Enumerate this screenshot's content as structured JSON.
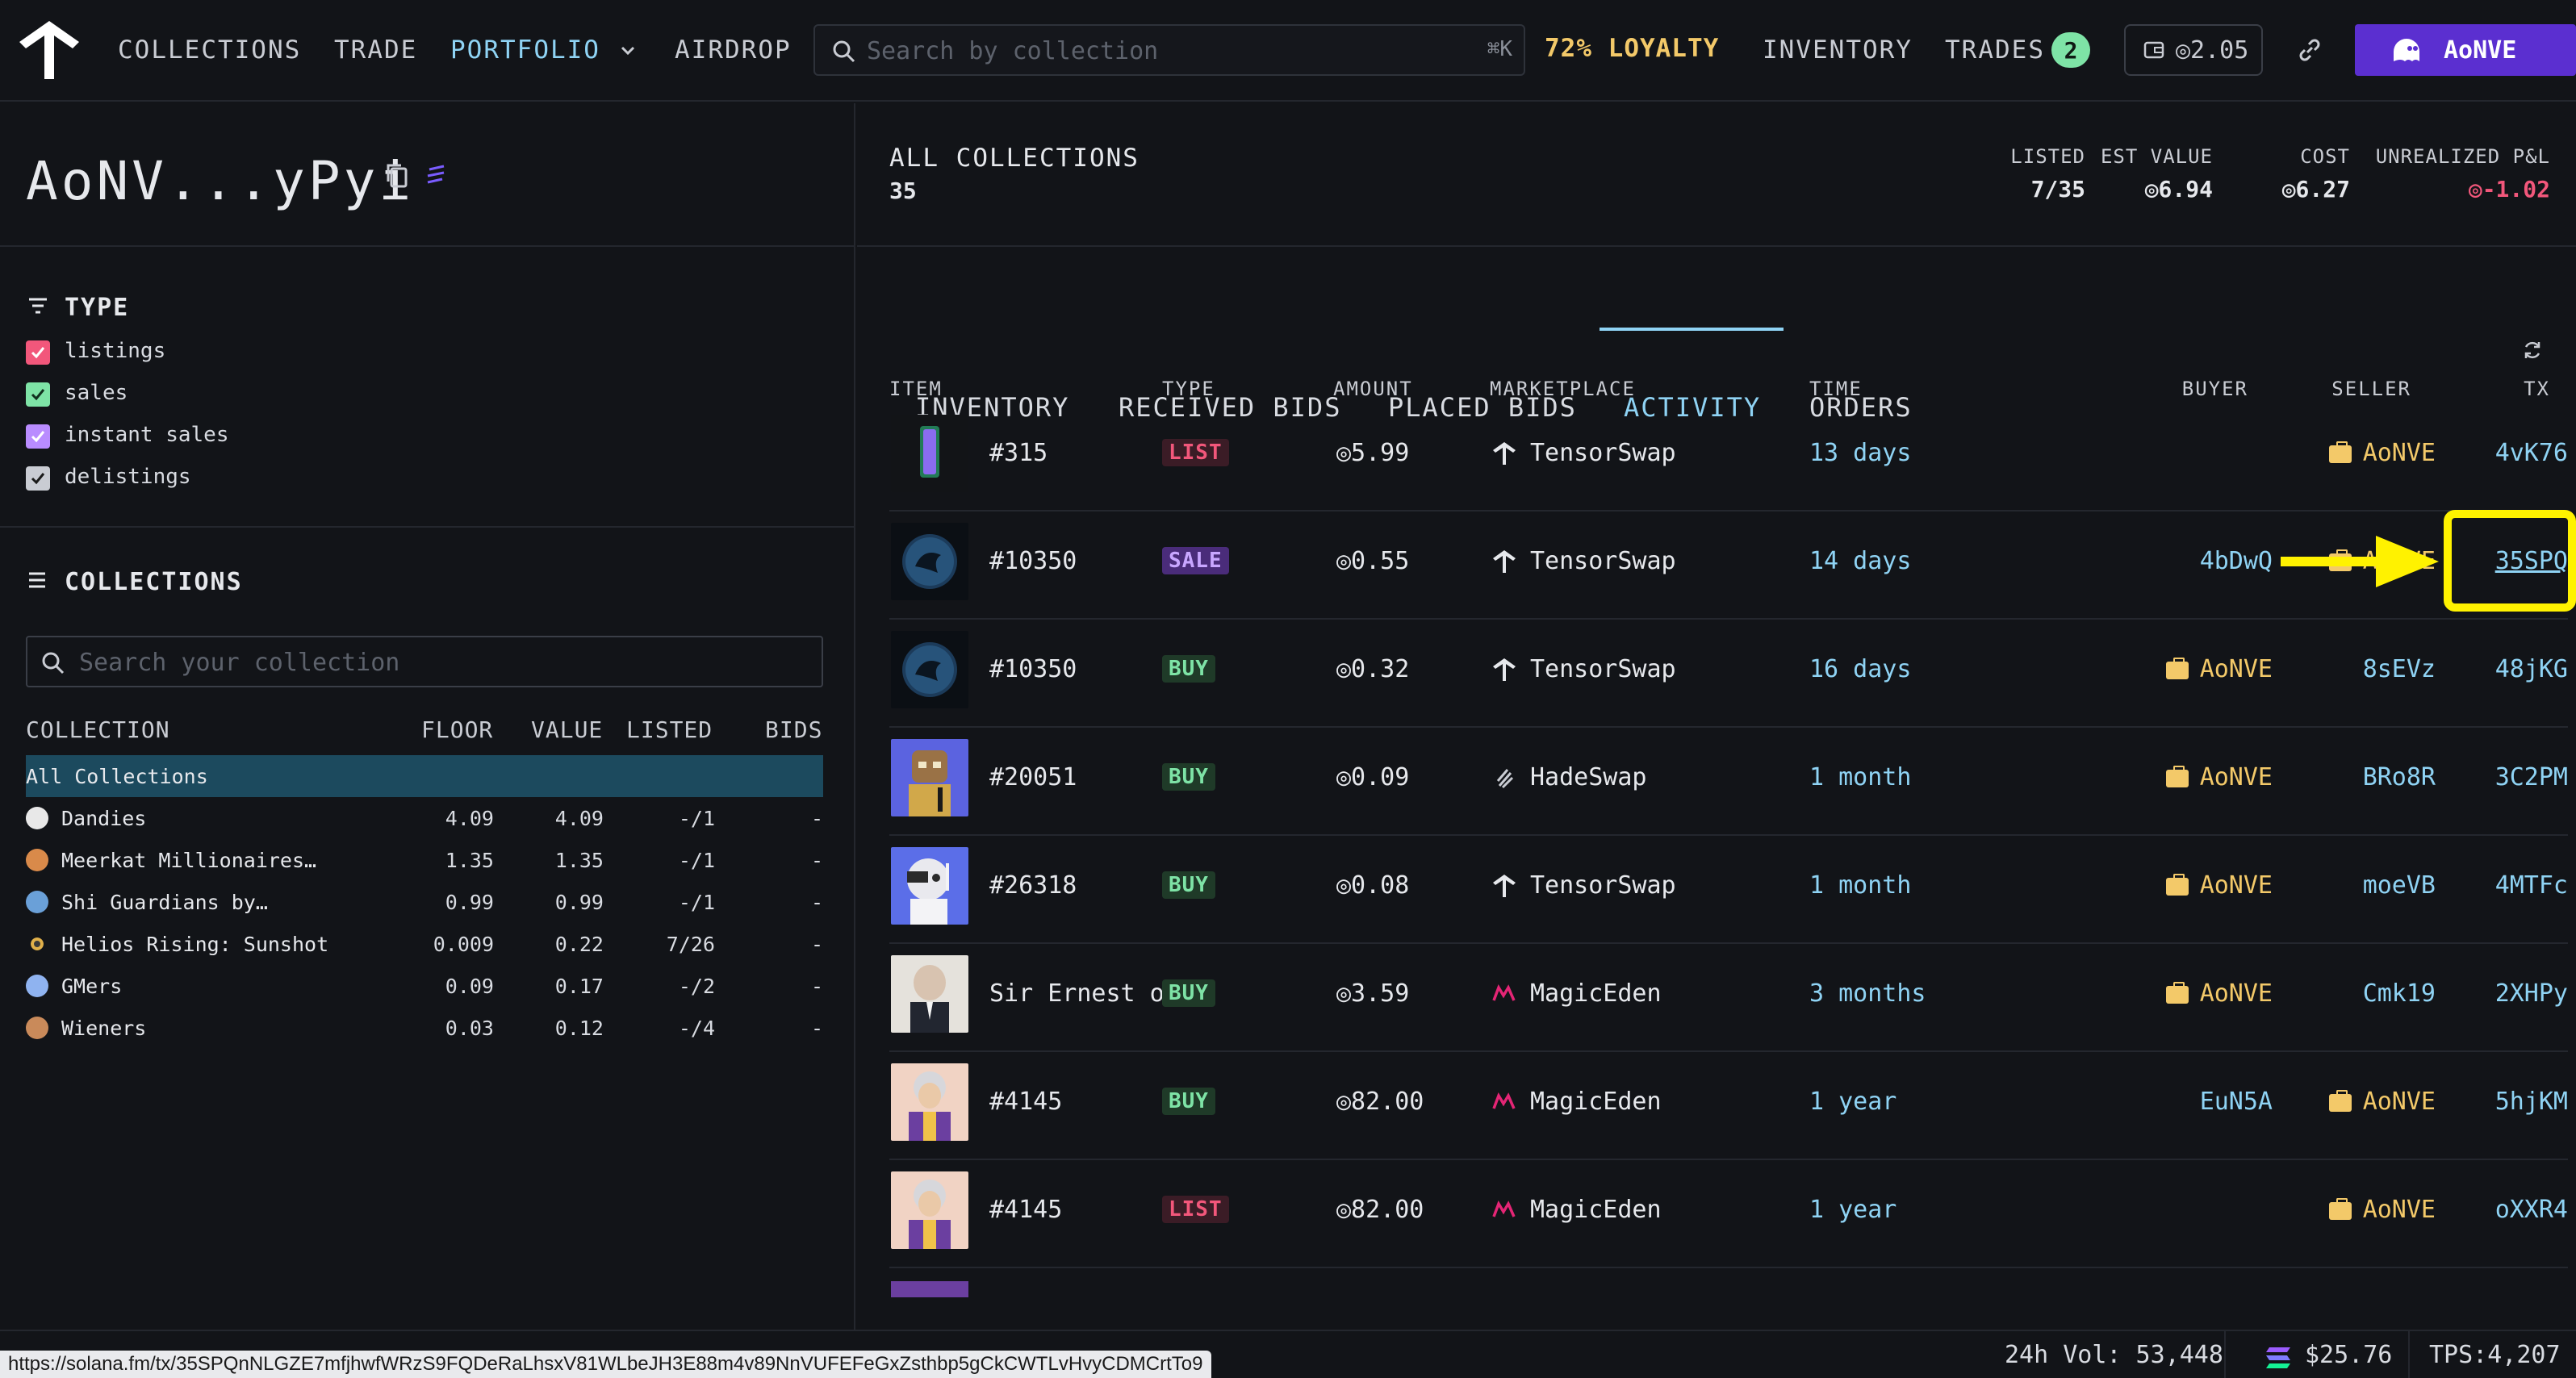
{
  "nav": {
    "collections": "COLLECTIONS",
    "trade": "TRADE",
    "portfolio": "PORTFOLIO",
    "airdrop": "AIRDROP",
    "search_placeholder": "Search by collection",
    "search_shortcut": "⌘K",
    "loyalty": "72% LOYALTY",
    "inventory": "INVENTORY",
    "trades": "TRADES",
    "trades_count": "2",
    "wallet_balance": "◎2.05",
    "user": "AoNVE"
  },
  "left": {
    "wallet_title": "AoNV...yPyi",
    "type_title": "TYPE",
    "types": [
      {
        "label": "listings",
        "color": "#f2577b"
      },
      {
        "label": "sales",
        "color": "#7ee3a6"
      },
      {
        "label": "instant sales",
        "color": "#b98cff"
      },
      {
        "label": "delistings",
        "color": "#c9ccd3"
      }
    ],
    "collections_title": "COLLECTIONS",
    "search_placeholder": "Search your collection",
    "headers": {
      "collection": "COLLECTION",
      "floor": "FLOOR",
      "value": "VALUE",
      "listed": "LISTED",
      "bids": "BIDS"
    },
    "rows": [
      {
        "name": "All Collections",
        "floor": "",
        "value": "",
        "listed": "",
        "bids": "",
        "color": ""
      },
      {
        "name": "Dandies",
        "floor": "4.09",
        "value": "4.09",
        "listed": "-/1",
        "bids": "-",
        "color": "#e8e8e8"
      },
      {
        "name": "Meerkat Millionaires…",
        "floor": "1.35",
        "value": "1.35",
        "listed": "-/1",
        "bids": "-",
        "color": "#d98a4a"
      },
      {
        "name": "Shi Guardians by…",
        "floor": "0.99",
        "value": "0.99",
        "listed": "-/1",
        "bids": "-",
        "color": "#6aa0d8"
      },
      {
        "name": "Helios Rising: Sunshot",
        "floor": "0.009",
        "value": "0.22",
        "listed": "7/26",
        "bids": "-",
        "color": "#2a2a2a"
      },
      {
        "name": "GMers",
        "floor": "0.09",
        "value": "0.17",
        "listed": "-/2",
        "bids": "-",
        "color": "#8fb3f0"
      },
      {
        "name": "Wieners",
        "floor": "0.03",
        "value": "0.12",
        "listed": "-/4",
        "bids": "-",
        "color": "#c98a5a"
      }
    ]
  },
  "summary": {
    "title": "ALL COLLECTIONS",
    "count": "35",
    "listed_label": "LISTED",
    "listed": "7/35",
    "est_label": "EST VALUE",
    "est": "◎6.94",
    "cost_label": "COST",
    "cost": "◎6.27",
    "pnl_label": "UNREALIZED P&L",
    "pnl": "◎-1.02"
  },
  "tabs": [
    "INVENTORY",
    "RECEIVED BIDS",
    "PLACED BIDS",
    "ACTIVITY",
    "ORDERS"
  ],
  "table": {
    "headers": {
      "item": "ITEM",
      "type": "TYPE",
      "amount": "AMOUNT",
      "marketplace": "MARKETPLACE",
      "time": "TIME",
      "buyer": "BUYER",
      "seller": "SELLER",
      "tx": "TX"
    },
    "rows": [
      {
        "item": "#315",
        "type": "LIST",
        "amount": "◎5.99",
        "market": "TensorSwap",
        "time": "13 days",
        "buyer": "",
        "seller": "AoNVE",
        "tx": "4vK76",
        "thumb": "#1a1f24"
      },
      {
        "item": "#10350",
        "type": "SALE",
        "amount": "◎0.55",
        "market": "TensorSwap",
        "time": "14 days",
        "buyer": "4bDwQ",
        "seller": "AoNVE",
        "tx": "35SPQ",
        "thumb": "#0d1a2a"
      },
      {
        "item": "#10350",
        "type": "BUY",
        "amount": "◎0.32",
        "market": "TensorSwap",
        "time": "16 days",
        "buyer": "AoNVE",
        "seller": "8sEVz",
        "tx": "48jKG",
        "thumb": "#0d1a2a"
      },
      {
        "item": "#20051",
        "type": "BUY",
        "amount": "◎0.09",
        "market": "HadeSwap",
        "time": "1 month",
        "buyer": "AoNVE",
        "seller": "BRo8R",
        "tx": "3C2PM",
        "thumb": "#5b63e0"
      },
      {
        "item": "#26318",
        "type": "BUY",
        "amount": "◎0.08",
        "market": "TensorSwap",
        "time": "1 month",
        "buyer": "AoNVE",
        "seller": "moeVB",
        "tx": "4MTFc",
        "thumb": "#5b6ee8"
      },
      {
        "item": "Sir Ernest of",
        "type": "BUY",
        "amount": "◎3.59",
        "market": "MagicEden",
        "time": "3 months",
        "buyer": "AoNVE",
        "seller": "Cmk19",
        "tx": "2XHPy",
        "thumb": "#e5e2dc"
      },
      {
        "item": "#4145",
        "type": "BUY",
        "amount": "◎82.00",
        "market": "MagicEden",
        "time": "1 year",
        "buyer": "EuN5A",
        "seller": "AoNVE",
        "tx": "5hjKM",
        "thumb": "#f1d3c4"
      },
      {
        "item": "#4145",
        "type": "LIST",
        "amount": "◎82.00",
        "market": "MagicEden",
        "time": "1 year",
        "buyer": "",
        "seller": "AoNVE",
        "tx": "oXXR4",
        "thumb": "#f1d3c4"
      }
    ]
  },
  "footer": {
    "url": "https://solana.fm/tx/35SPQnNLGZE7mfjhwfWRzS9FQDeRaLhsxV81WLbeJH3E88m4v89NnVUFEFeGxZsthbp5gCkCWTLvHvyCDMCrtTo9",
    "vol": "24h Vol: 53,448",
    "sol_price": "$25.76",
    "tps": "TPS:4,207"
  }
}
